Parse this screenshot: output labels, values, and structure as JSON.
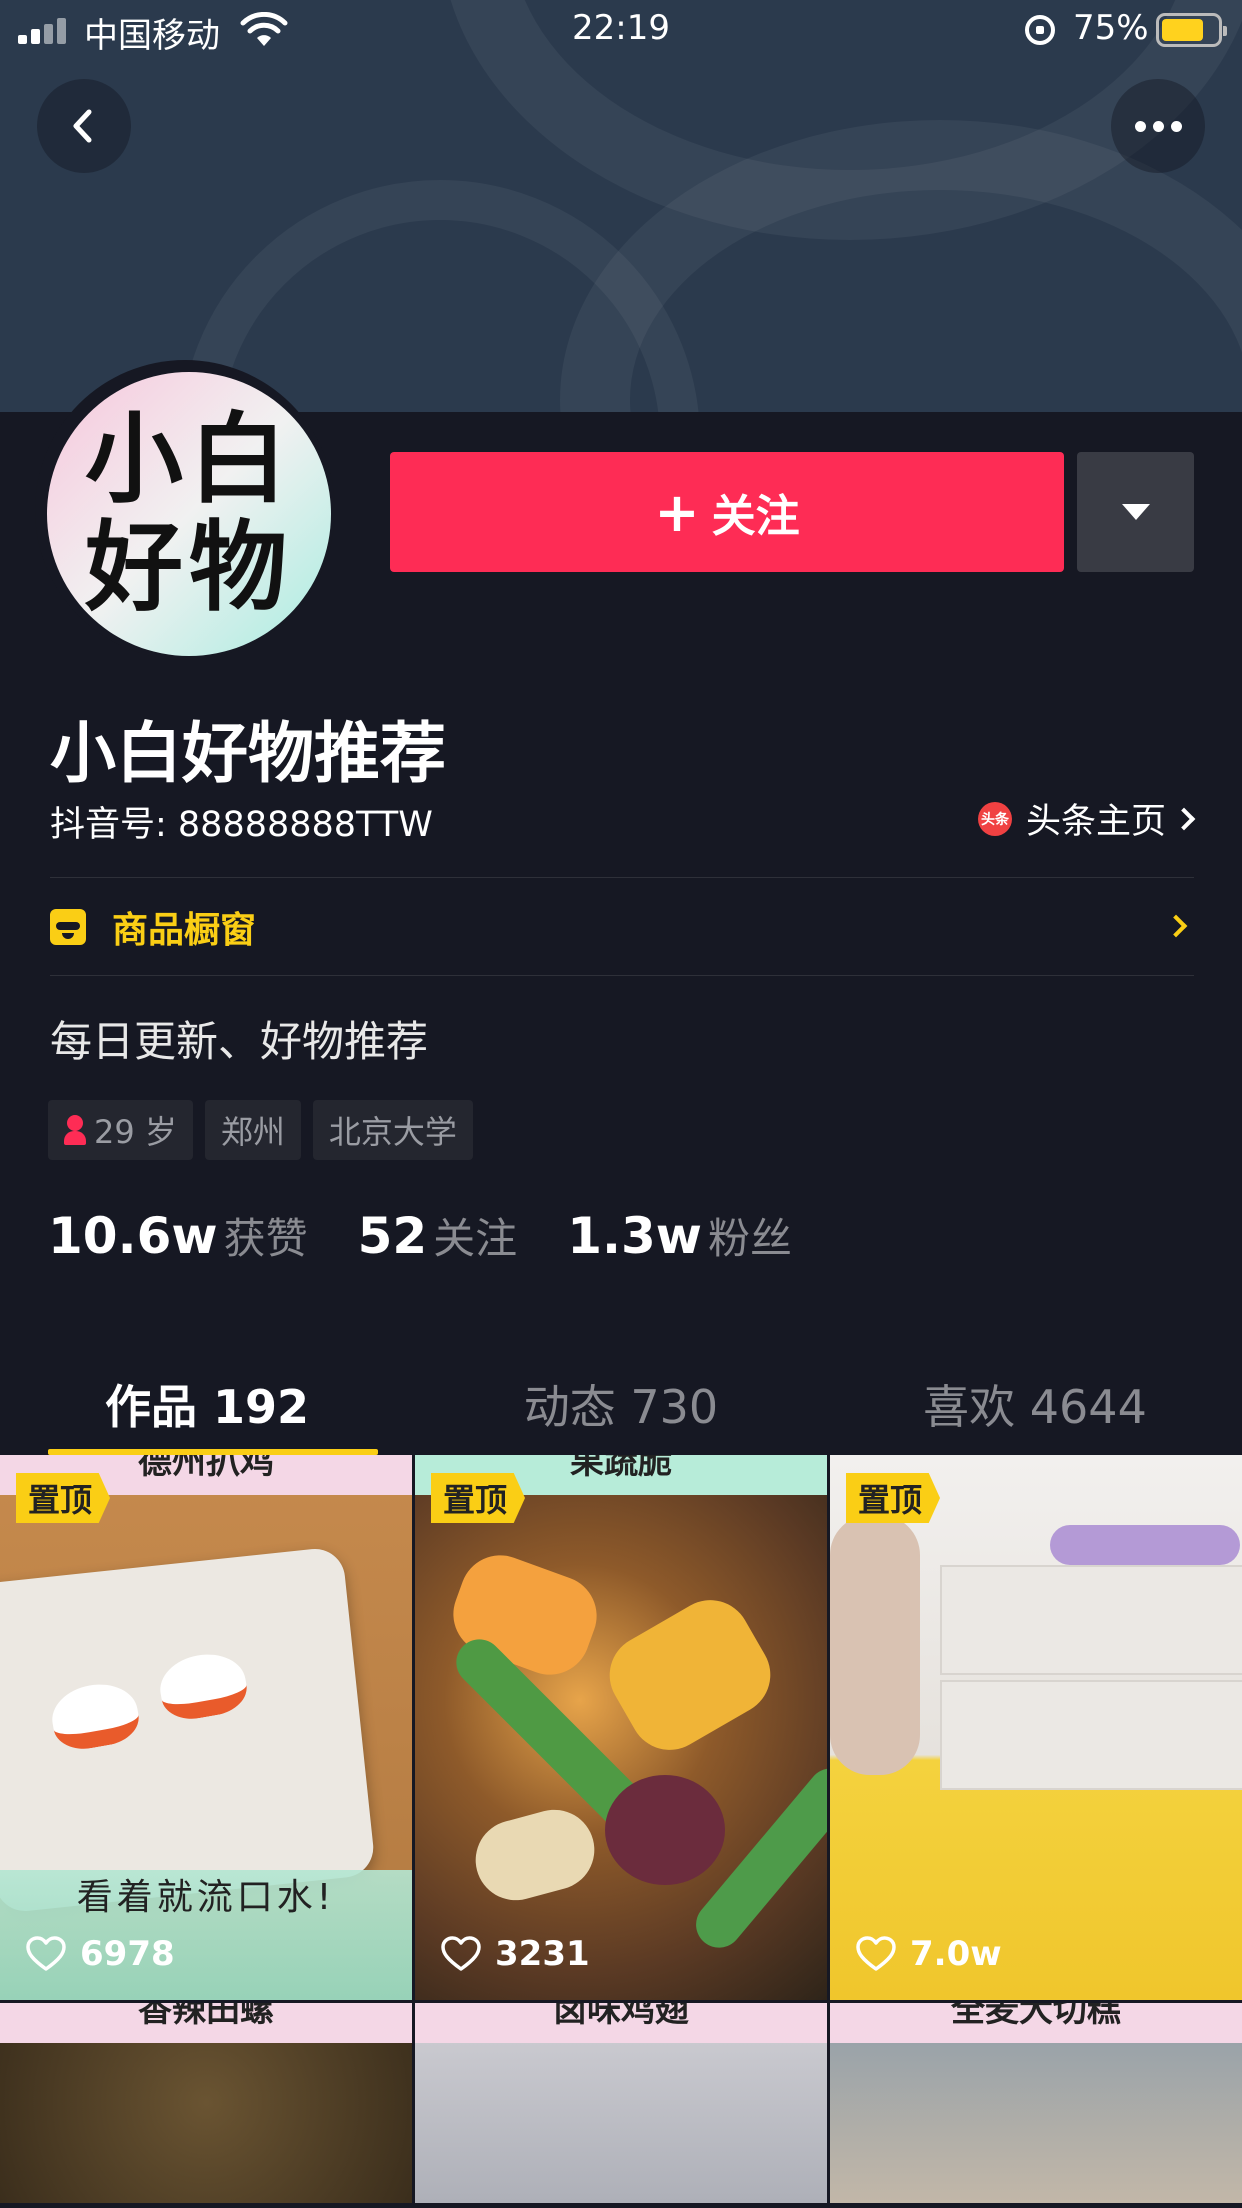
{
  "status_bar": {
    "carrier": "中国移动",
    "time": "22:19",
    "battery_percent": "75%",
    "battery_level": 0.75
  },
  "colors": {
    "accent": "#fe2c55",
    "highlight": "#face15",
    "background": "#161823",
    "banner": "#2b3a4d"
  },
  "header": {
    "back_icon": "chevron-left-icon",
    "more_icon": "more-dots-icon"
  },
  "profile": {
    "avatar_text_line1": "小白",
    "avatar_text_line2": "好物",
    "follow_label": "关注",
    "follow_icon": "plus-icon",
    "nickname": "小白好物推荐",
    "douyin_id": "抖音号: 88888888TTW",
    "toutiao_logo": "头条",
    "toutiao_link": "头条主页",
    "shop_label": "商品橱窗",
    "bio": "每日更新、好物推荐",
    "tags": {
      "age": "29 岁",
      "city": "郑州",
      "school": "北京大学"
    },
    "stats": [
      {
        "value": "10.6w",
        "label": "获赞"
      },
      {
        "value": "52",
        "label": "关注"
      },
      {
        "value": "1.3w",
        "label": "粉丝"
      }
    ]
  },
  "tabs": [
    {
      "label": "作品 192",
      "active": true
    },
    {
      "label": "动态 730",
      "active": false
    },
    {
      "label": "喜欢 4644",
      "active": false
    }
  ],
  "videos": [
    {
      "pinned_label": "置顶",
      "likes": "6978",
      "top_caption": "德州扒鸡",
      "overlay": "看着就流口水!"
    },
    {
      "pinned_label": "置顶",
      "likes": "3231",
      "top_caption": "果蔬脆"
    },
    {
      "pinned_label": "置顶",
      "likes": "7.0w"
    },
    {
      "top_caption": "香辣田螺"
    },
    {
      "top_caption": "卤味鸡翅"
    },
    {
      "top_caption": "全麦大切糕"
    }
  ]
}
